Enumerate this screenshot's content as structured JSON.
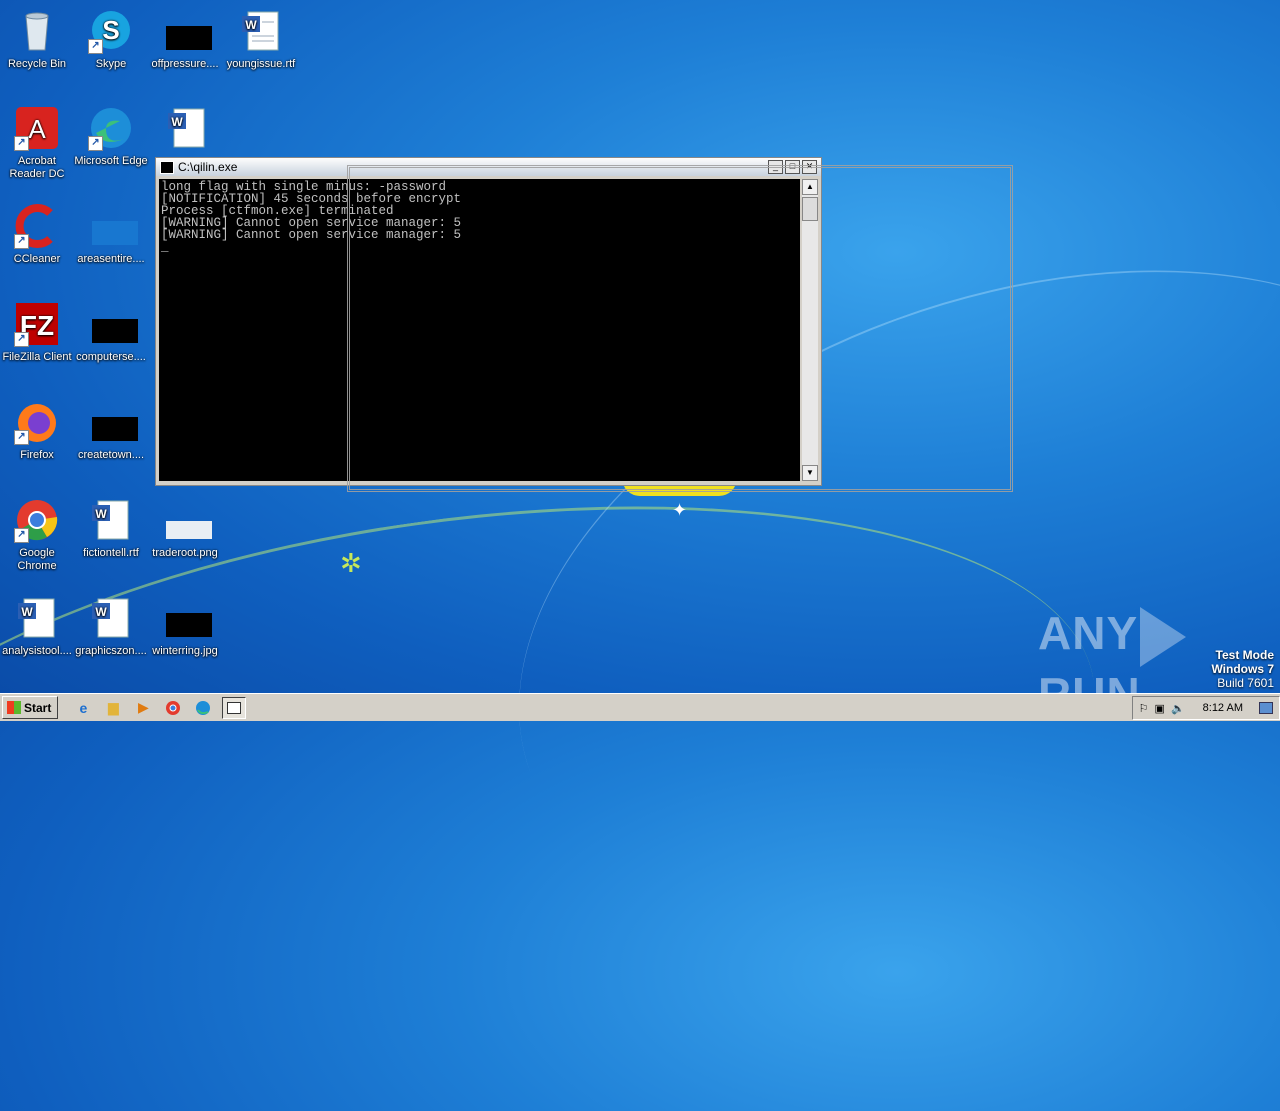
{
  "desktop": {
    "icons": [
      {
        "label": "Recycle Bin"
      },
      {
        "label": "Skype"
      },
      {
        "label": "offpressure...."
      },
      {
        "label": "youngissue.rtf"
      },
      {
        "label": "Acrobat Reader DC"
      },
      {
        "label": "Microsoft Edge"
      },
      {
        "label": "CCleaner"
      },
      {
        "label": "areasentire...."
      },
      {
        "label": "FileZilla Client"
      },
      {
        "label": "computerse...."
      },
      {
        "label": "Firefox"
      },
      {
        "label": "createtown...."
      },
      {
        "label": "Google Chrome"
      },
      {
        "label": "fictiontell.rtf"
      },
      {
        "label": "traderoot.png"
      },
      {
        "label": "analysistool...."
      },
      {
        "label": "graphicszon...."
      },
      {
        "label": "winterring.jpg"
      }
    ]
  },
  "console": {
    "title": "C:\\qilin.exe",
    "lines": [
      "long flag with single minus: -password",
      "[NOTIFICATION] 45 seconds before encrypt",
      "Process [ctfmon.exe] terminated",
      "[WARNING] Cannot open service manager: 5",
      "[WARNING] Cannot open service manager: 5",
      "_"
    ]
  },
  "watermark": {
    "text_left": "ANY",
    "text_right": "RUN"
  },
  "os_info": {
    "line1": "Test Mode",
    "line2": "Windows 7",
    "line3": "Build 7601"
  },
  "taskbar": {
    "start_label": "Start",
    "clock": "8:12 AM"
  },
  "colors": {
    "console_bg": "#000000",
    "desktop_blue": "#1e7fd6",
    "taskbar": "#d4d0c8"
  }
}
